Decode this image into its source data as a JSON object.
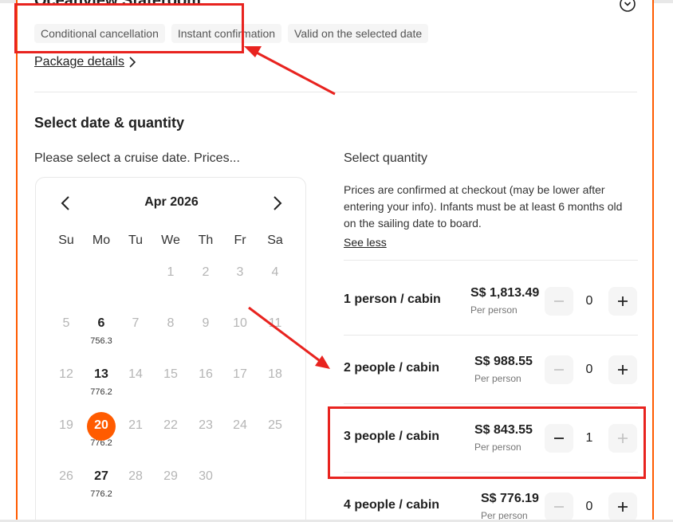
{
  "room": {
    "title": "Oceanview Stateroom",
    "tags": [
      "Conditional cancellation",
      "Instant confirmation",
      "Valid on the selected date"
    ],
    "package_link": "Package details"
  },
  "section_title": "Select date & quantity",
  "calendar": {
    "hint": "Please select a cruise date. Prices...",
    "month": "Apr 2026",
    "weekdays": [
      "Su",
      "Mo",
      "Tu",
      "We",
      "Th",
      "Fr",
      "Sa"
    ],
    "days": {
      "d1": "1",
      "d2": "2",
      "d3": "3",
      "d4": "4",
      "d5": "5",
      "d6": "6",
      "d7": "7",
      "d8": "8",
      "d9": "9",
      "d10": "10",
      "d11": "11",
      "d12": "12",
      "d13": "13",
      "d14": "14",
      "d15": "15",
      "d16": "16",
      "d17": "17",
      "d18": "18",
      "d19": "19",
      "d20": "20",
      "d21": "21",
      "d22": "22",
      "d23": "23",
      "d24": "24",
      "d25": "25",
      "d26": "26",
      "d27": "27",
      "d28": "28",
      "d29": "29",
      "d30": "30"
    },
    "prices": {
      "d6": "756.3",
      "d13": "776.2",
      "d20": "776.2",
      "d27": "776.2"
    },
    "selected_day": "20"
  },
  "quantity": {
    "header": "Select quantity",
    "description": "Prices are confirmed at checkout (may be lower after entering your info). Infants must be at least 6 months old on the sailing date to board.",
    "see_less": "See less",
    "rows": [
      {
        "label": "1 person / cabin",
        "price": "S$ 1,813.49",
        "per": "Per person",
        "value": "0"
      },
      {
        "label": "2 people / cabin",
        "price": "S$ 988.55",
        "per": "Per person",
        "value": "0"
      },
      {
        "label": "3 people / cabin",
        "price": "S$ 843.55",
        "per": "Per person",
        "value": "1"
      },
      {
        "label": "4 people / cabin",
        "price": "S$ 776.19",
        "per": "Per person",
        "value": "0"
      }
    ]
  },
  "colors": {
    "accent": "#ff5b00",
    "annotation": "#e8231f",
    "text": "#212121",
    "muted": "#b5b5b5"
  }
}
